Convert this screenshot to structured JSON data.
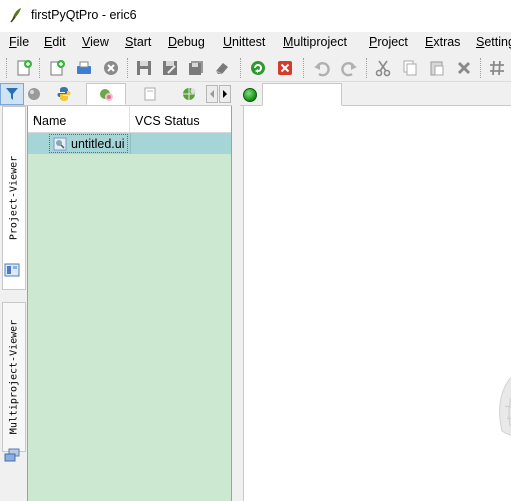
{
  "window": {
    "title": "firstPyQtPro - eric6",
    "app_icon": "eric-icon"
  },
  "menu": {
    "items": [
      "File",
      "Edit",
      "View",
      "Start",
      "Debug",
      "Unittest",
      "Multiproject",
      "Project",
      "Extras",
      "Settings"
    ]
  },
  "toolbar": {
    "buttons": [
      "new-file-icon",
      "new-project-icon",
      "print-icon",
      "close-circle-icon",
      "save-icon",
      "save-as-icon",
      "save-all-icon",
      "erase-icon",
      "reload-icon",
      "close-red-icon",
      "undo-icon",
      "redo-icon",
      "cut-icon",
      "copy-icon",
      "paste-icon",
      "delete-icon",
      "hash-icon"
    ]
  },
  "left_dock": {
    "vertical_tabs": [
      {
        "label": "Project-Viewer",
        "icon": "project-viewer-icon"
      },
      {
        "label": "Multiproject-Viewer",
        "icon": "multiproject-viewer-icon"
      }
    ],
    "horizontal_tabs": [
      "filter-icon",
      "sphere-icon",
      "python-icon",
      "forms-icon",
      "resources-icon",
      "translations-icon"
    ],
    "active_tab": "forms-icon"
  },
  "tree": {
    "columns": [
      {
        "label": "Name"
      },
      {
        "label": "VCS Status"
      }
    ],
    "rows": [
      {
        "name": "untitled.ui",
        "vcs_status": "",
        "icon": "ui-form-icon",
        "selected": true
      }
    ],
    "background_color": "#cde8d0",
    "selected_row_color": "#a6d5d8"
  },
  "editor": {
    "status_indicator": "green-status-dot",
    "status_color": "#1ea31e"
  }
}
